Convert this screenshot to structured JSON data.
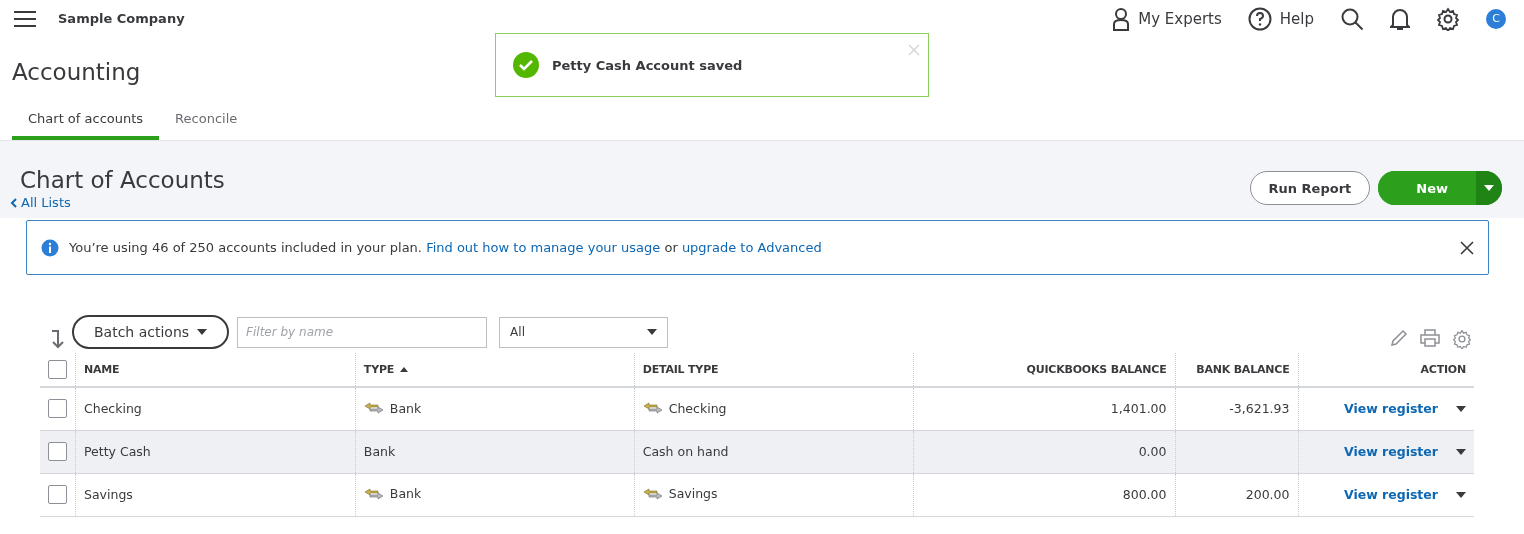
{
  "topbar": {
    "company": "Sample Company",
    "experts": "My Experts",
    "help": "Help",
    "avatar": "C"
  },
  "toast": {
    "message": "Petty Cash Account saved"
  },
  "page": {
    "title": "Accounting"
  },
  "tabs": [
    {
      "label": "Chart of accounts",
      "selected": true
    },
    {
      "label": "Reconcile",
      "selected": false
    }
  ],
  "header": {
    "title": "Chart of Accounts",
    "back_link": "All Lists",
    "run_report": "Run Report",
    "new_button": "New"
  },
  "banner": {
    "text": "You’re using 46 of 250 accounts included in your plan.",
    "link1": "Find out how to manage your usage",
    "or": "or",
    "link2": "upgrade to Advanced"
  },
  "toolbar": {
    "batch": "Batch actions",
    "filter_placeholder": "Filter by name",
    "type_filter": "All"
  },
  "table": {
    "all_checked": false,
    "columns": [
      {
        "label": "NAME",
        "sorted": false
      },
      {
        "label": "TYPE",
        "sorted": true
      },
      {
        "label": "DETAIL TYPE",
        "sorted": false
      },
      {
        "label": "QUICKBOOKS BALANCE",
        "sorted": false
      },
      {
        "label": "BANK BALANCE",
        "sorted": false
      },
      {
        "label": "ACTION",
        "sorted": false
      }
    ],
    "rows": [
      {
        "name": "Checking",
        "type": "Bank",
        "type_icon": true,
        "detail": "Checking",
        "detail_icon": true,
        "qb_balance": "1,401.00",
        "bank_balance": "-3,621.93",
        "action": "View register",
        "checked": false,
        "highlighted": false
      },
      {
        "name": "Petty Cash",
        "type": "Bank",
        "type_icon": false,
        "detail": "Cash on hand",
        "detail_icon": false,
        "qb_balance": "0.00",
        "action": "View register",
        "checked": false,
        "highlighted": true
      },
      {
        "name": "Savings",
        "type": "Bank",
        "type_icon": true,
        "detail": "Savings",
        "detail_icon": true,
        "qb_balance": "800.00",
        "bank_balance": "200.00",
        "action": "View register",
        "checked": false,
        "highlighted": false
      }
    ]
  }
}
